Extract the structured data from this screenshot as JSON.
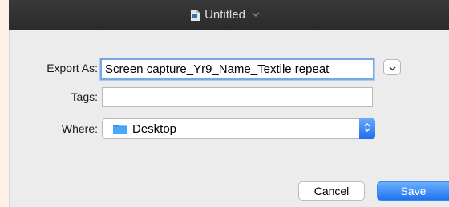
{
  "window": {
    "title": "Untitled",
    "title_chevron_icon": "chevron-down-icon",
    "doc_icon": "document-icon"
  },
  "form": {
    "export_as_label": "Export As:",
    "export_as_value": "Screen capture_Yr9_Name_Textile repeat",
    "tags_label": "Tags:",
    "tags_value": "",
    "where_label": "Where:",
    "where_value": "Desktop",
    "where_icon": "folder-icon",
    "expand_icon": "chevron-down-icon"
  },
  "buttons": {
    "cancel_label": "Cancel",
    "save_label": "Save"
  },
  "colors": {
    "accent": "#1f73ef",
    "titlebar": "#2f2f2f",
    "sheet": "#ececec",
    "focus_ring": "#7aa7e3",
    "folder": "#3ea0f5"
  }
}
